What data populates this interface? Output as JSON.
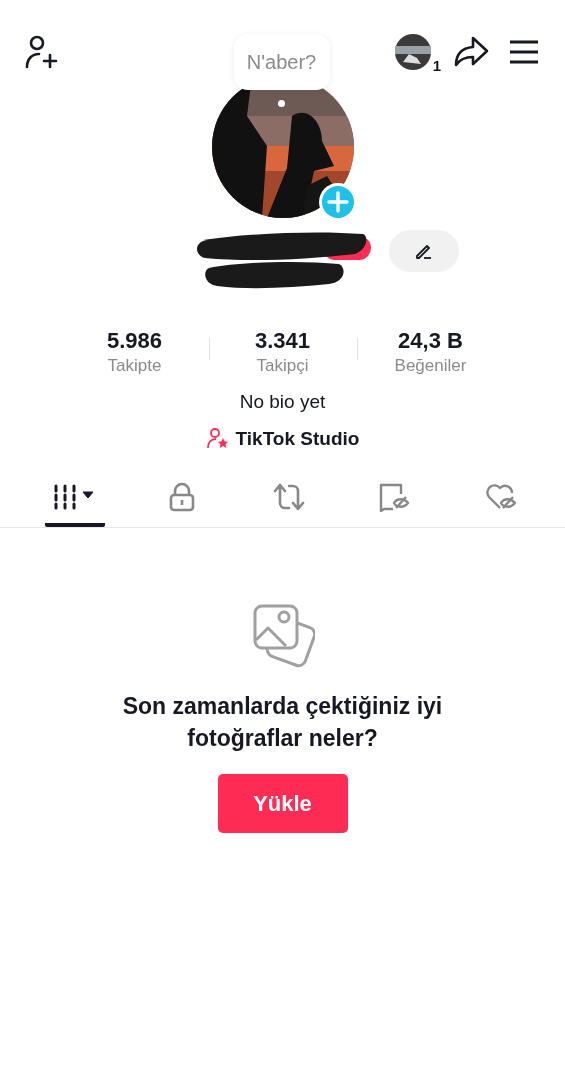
{
  "top_bar": {
    "story_count": "1"
  },
  "status_bubble": {
    "placeholder": "N'aber?"
  },
  "stats": [
    {
      "value": "5.986",
      "label": "Takipte"
    },
    {
      "value": "3.341",
      "label": "Takipçi"
    },
    {
      "value": "24,3 B",
      "label": "Beğeniler"
    }
  ],
  "bio": "No bio yet",
  "studio_link": "TikTok Studio",
  "tabs": [
    {
      "kind": "videos",
      "selected": true
    },
    {
      "kind": "private",
      "selected": false
    },
    {
      "kind": "reposts",
      "selected": false
    },
    {
      "kind": "favorites",
      "selected": false
    },
    {
      "kind": "liked",
      "selected": false
    }
  ],
  "empty_state": {
    "message": "Son zamanlarda çektiğiniz iyi fotoğraflar neler?",
    "button": "Yükle"
  }
}
